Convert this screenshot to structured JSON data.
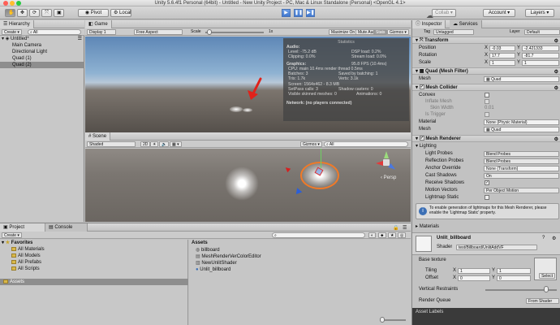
{
  "window": {
    "title": "Unity 5.6.4f1 Personal (64bit) - Untitled - New Unity Project - PC, Mac & Linux Standalone (Personal) <OpenGL 4.1>",
    "colors": {
      "close": "#ff5f57",
      "min": "#ffbd2e",
      "max": "#28c940"
    }
  },
  "toolbar": {
    "pivot": "Pivot",
    "local": "Local",
    "play": "▶",
    "pause": "❚❚",
    "step": "▶❚",
    "cloud": "☁",
    "collab": "Collab ▾",
    "account": "Account",
    "layers": "Layers"
  },
  "hierarchy": {
    "tab": "Hierarchy",
    "create": "Create ▾",
    "search": "All",
    "scene": "Untitled*",
    "items": [
      "Main Camera",
      "Directional Light",
      "Quad (1)",
      "Quad (2)"
    ]
  },
  "game": {
    "tab": "Game",
    "display": "Display 1",
    "aspect": "Free Aspect",
    "scale_label": "Scale",
    "scale_value": "1x",
    "maximize": "Maximize On Play",
    "mute": "Mute Audio",
    "stats": "Stats",
    "gizmos": "Gizmos ▾"
  },
  "stats": {
    "title": "Statistics",
    "audio_h": "Audio:",
    "level": "Level: -75.2 dB",
    "clipping": "Clipping: 0.0%",
    "dsp": "DSP load: 0.2%",
    "stream": "Stream load: 0.0%",
    "graphics_h": "Graphics:",
    "fps": "95.8 FPS (10.4ms)",
    "cpu": "CPU: main 10.4ms  render thread 0.5ms",
    "batches": "Batches: 3",
    "saved": "Saved by batching: 1",
    "tris": "Tris: 1.7k",
    "verts": "Verts: 3.1k",
    "screen": "Screen: 1564x462 - 8.3 MB",
    "setpass": "SetPass calls: 3",
    "shadow": "Shadow casters: 0",
    "skinned": "Visible skinned meshes: 0",
    "anims": "Animations: 0",
    "network": "Network: (no players connected)"
  },
  "scene": {
    "tab": "Scene",
    "shading": "Shaded",
    "mode2d": "2D",
    "gizmos": "Gizmos ▾",
    "search": "All",
    "persp": "Persp"
  },
  "project": {
    "tab": "Project",
    "console_tab": "Console",
    "create": "Create ▾",
    "favorites": "Favorites",
    "fav_items": [
      "All Materials",
      "All Models",
      "All Prefabs",
      "All Scripts"
    ],
    "assets_root": "Assets",
    "assets_header": "Assets",
    "assets": [
      "billboard",
      "MeshRenderVerColorEditor",
      "NewUnlitShader",
      "Unlit_billboard"
    ]
  },
  "inspector": {
    "tab": "Inspector",
    "services_tab": "Services",
    "tag_label": "Tag",
    "tag_value": "Untagged",
    "layer_label": "Layer",
    "layer_value": "Default",
    "transform": "Transform",
    "position": "Position",
    "rotation": "Rotation",
    "scale": "Scale",
    "pos": {
      "x": "-0.03",
      "y": "-2.421333",
      "z": ""
    },
    "rot": {
      "x": "17.7",
      "y": "-81.7",
      "z": ""
    },
    "scl": {
      "x": "1",
      "y": "1",
      "z": ""
    },
    "x": "X",
    "y": "Y",
    "z": "Z",
    "mesh_filter": "Quad (Mesh Filter)",
    "mesh_label": "Mesh",
    "mesh_value": "Quad",
    "mesh_collider": "Mesh Collider",
    "convex": "Convex",
    "inflate": "Inflate Mesh",
    "skin_width": "Skin Width",
    "skin_value": "0.01",
    "is_trigger": "Is Trigger",
    "material_label": "Material",
    "material_value": "None (Physic Material)",
    "collider_mesh_label": "Mesh",
    "collider_mesh_value": "Quad",
    "mesh_renderer": "Mesh Renderer",
    "lighting": "Lighting",
    "light_probes": "Light Probes",
    "light_probes_v": "Blend Probes",
    "refl_probes": "Reflection Probes",
    "refl_probes_v": "Blend Probes",
    "anchor": "Anchor Override",
    "anchor_v": "None (Transform)",
    "cast_shadows": "Cast Shadows",
    "cast_shadows_v": "On",
    "receive_shadows": "Receive Shadows",
    "motion_vectors": "Motion Vectors",
    "motion_vectors_v": "Per Object Motion",
    "lightmap_static": "Lightmap Static",
    "info": "To enable generation of lightmaps for this Mesh Renderer, please enable the 'Lightmap Static' property.",
    "materials": "Materials",
    "material_name": "Unlit_billboard",
    "shader_label": "Shader",
    "shader_value": "test/Billboard/UnlitAddVF",
    "base_texture": "Base texture",
    "tiling": "Tiling",
    "offset": "Offset",
    "tiling_x": "1",
    "tiling_y": "1",
    "offset_x": "0",
    "offset_y": "0",
    "select": "Select",
    "vertical": "Vertical Restraints",
    "vertical_level": 0.88,
    "render_queue": "Render Queue",
    "render_queue_v": "From Shader",
    "asset_labels": "Asset Labels"
  }
}
